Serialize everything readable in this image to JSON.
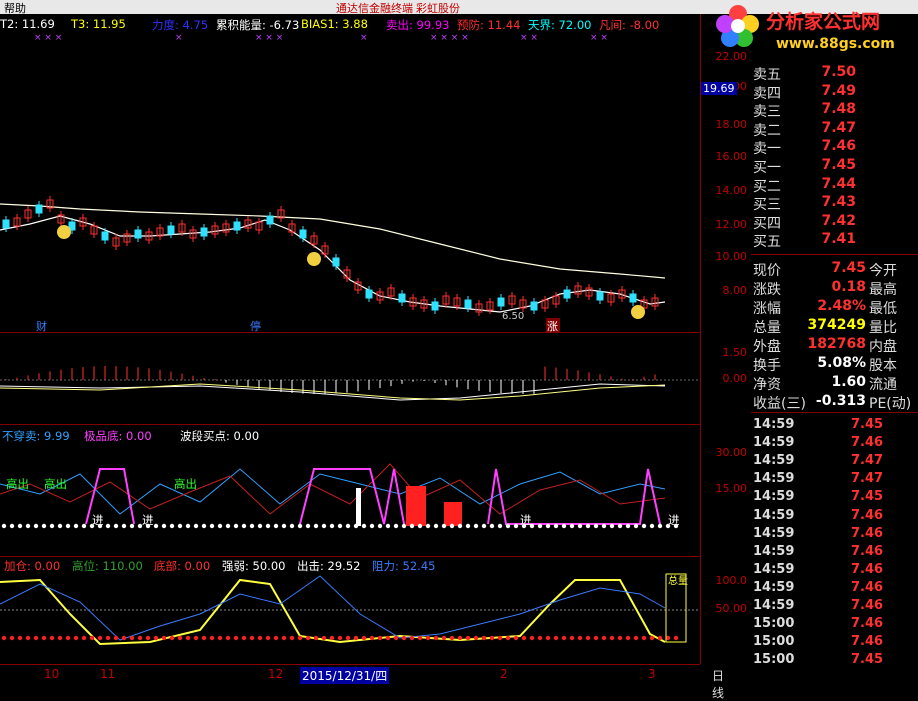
{
  "topbar": {
    "menu": "帮助",
    "title": "通达信金融终端   彩虹股份"
  },
  "logo": {
    "name": "分析家公式网",
    "url": "www.88gs.com"
  },
  "main_indicators": [
    {
      "text": "T2: 11.69",
      "color": "#ffffff"
    },
    {
      "text": "T3: 11.95",
      "color": "#ffff00"
    },
    {
      "text": "力度: 4.75",
      "color": "#3030ff"
    },
    {
      "text": "累积能量: -6.73",
      "color": "#ffffff"
    },
    {
      "text": "BIAS1: 3.88",
      "color": "#ffff00"
    },
    {
      "text": "卖出: 99.93",
      "color": "#ff00ff"
    },
    {
      "text": "预防: 11.44",
      "color": "#ff3030"
    },
    {
      "text": "天界: 72.00",
      "color": "#00ffff"
    },
    {
      "text": "凡间: -8.00",
      "color": "#ff3030"
    }
  ],
  "main_axis": [
    "22.00",
    "20.00",
    "19.69",
    "18.00",
    "16.00",
    "14.00",
    "12.00",
    "10.00",
    "8.00"
  ],
  "main_tags": {
    "cai": "财",
    "ting": "停",
    "zhang": "涨",
    "low_price": "6.50"
  },
  "macd_axis": [
    "1.50",
    "0.00"
  ],
  "pane3": {
    "label1": "不穿卖: 9.99",
    "label2": "极品底: 0.00",
    "label3": "波段买点: 0.00",
    "axis": [
      "30.00",
      "15.00"
    ],
    "gaochu": "高出",
    "jin": "进"
  },
  "pane4": {
    "items": [
      "加仓: 0.00",
      "高位: 110.00",
      "底部: 0.00",
      "强弱: 50.00",
      "出击: 29.52",
      "阻力: 52.45"
    ],
    "axis": [
      "100.0",
      "50.00"
    ],
    "zhongjun": "总量"
  },
  "dates": [
    "10",
    "11",
    "12",
    "2015/12/31/四",
    "2",
    "3"
  ],
  "period": "日线",
  "quote": [
    {
      "l": "卖五",
      "v": "7.50",
      "c": "#ff3030"
    },
    {
      "l": "卖四",
      "v": "7.49",
      "c": "#ff3030"
    },
    {
      "l": "卖三",
      "v": "7.48",
      "c": "#ff3030"
    },
    {
      "l": "卖二",
      "v": "7.47",
      "c": "#ff3030"
    },
    {
      "l": "卖一",
      "v": "7.46",
      "c": "#ff3030"
    },
    {
      "l": "买一",
      "v": "7.45",
      "c": "#ff3030"
    },
    {
      "l": "买二",
      "v": "7.44",
      "c": "#ff3030"
    },
    {
      "l": "买三",
      "v": "7.43",
      "c": "#ff3030"
    },
    {
      "l": "买四",
      "v": "7.42",
      "c": "#ff3030"
    },
    {
      "l": "买五",
      "v": "7.41",
      "c": "#ff3030"
    }
  ],
  "stats": [
    {
      "l": "现价",
      "v": "7.45",
      "r": "今开",
      "c": "#ff3030"
    },
    {
      "l": "涨跌",
      "v": "0.18",
      "r": "最高",
      "c": "#ff3030"
    },
    {
      "l": "涨幅",
      "v": "2.48%",
      "r": "最低",
      "c": "#ff3030"
    },
    {
      "l": "总量",
      "v": "374249",
      "r": "量比",
      "c": "#ffff00"
    },
    {
      "l": "外盘",
      "v": "182768",
      "r": "内盘",
      "c": "#ff3030"
    },
    {
      "l": "换手",
      "v": "5.08%",
      "r": "股本",
      "c": "#ffffff"
    },
    {
      "l": "净资",
      "v": "1.60",
      "r": "流通",
      "c": "#ffffff"
    },
    {
      "l": "收益(三)",
      "v": "-0.313",
      "r": "PE(动)",
      "c": "#ffffff"
    }
  ],
  "ticks": [
    {
      "t": "14:59",
      "p": "7.45"
    },
    {
      "t": "14:59",
      "p": "7.46"
    },
    {
      "t": "14:59",
      "p": "7.47"
    },
    {
      "t": "14:59",
      "p": "7.47"
    },
    {
      "t": "14:59",
      "p": "7.45"
    },
    {
      "t": "14:59",
      "p": "7.46"
    },
    {
      "t": "14:59",
      "p": "7.46"
    },
    {
      "t": "14:59",
      "p": "7.46"
    },
    {
      "t": "14:59",
      "p": "7.46"
    },
    {
      "t": "14:59",
      "p": "7.46"
    },
    {
      "t": "14:59",
      "p": "7.46"
    },
    {
      "t": "15:00",
      "p": "7.46"
    },
    {
      "t": "15:00",
      "p": "7.46"
    },
    {
      "t": "15:00",
      "p": "7.45"
    }
  ]
}
